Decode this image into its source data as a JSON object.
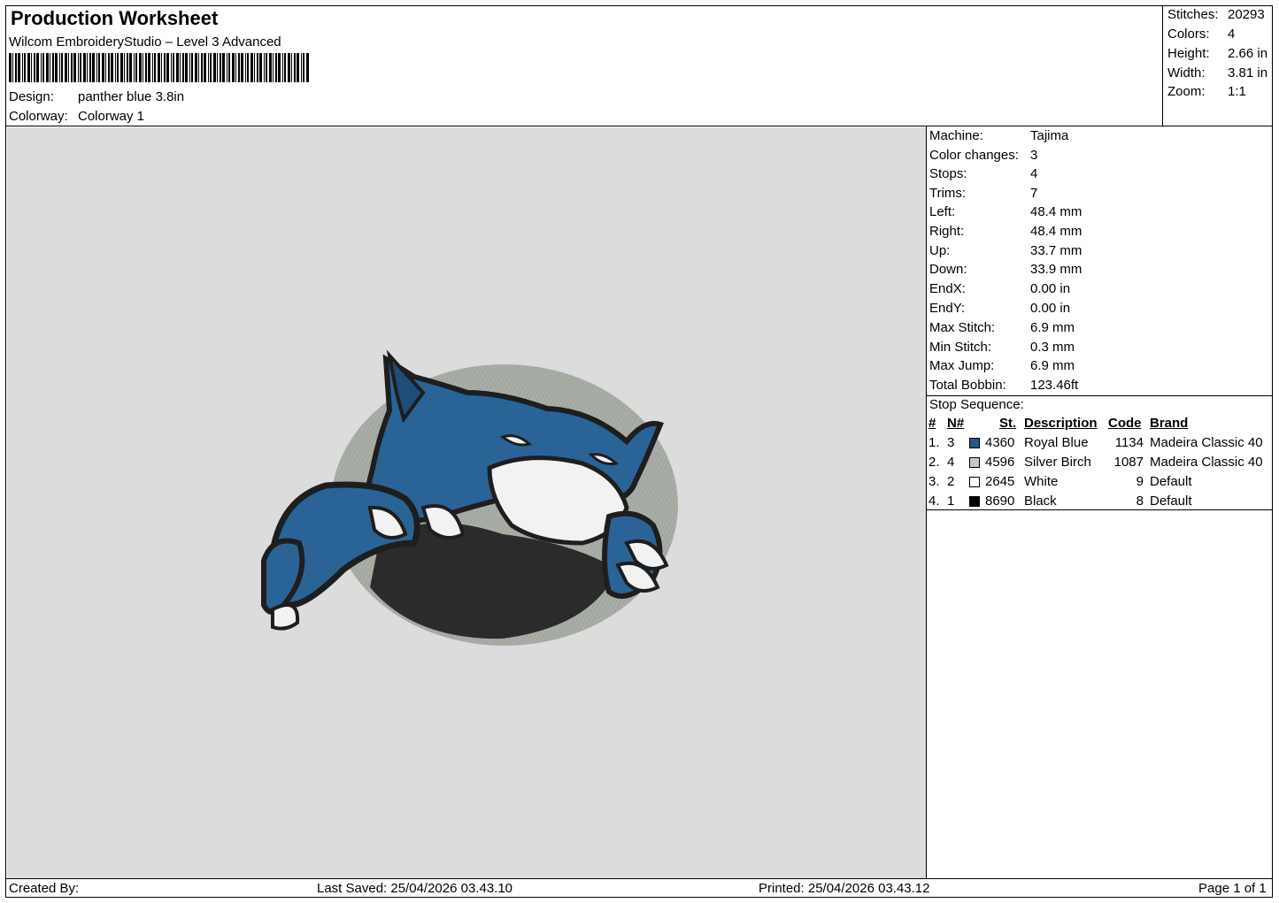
{
  "header": {
    "title": "Production Worksheet",
    "software": "Wilcom EmbroideryStudio – Level 3 Advanced",
    "design_label": "Design:",
    "design_value": "panther blue 3.8in",
    "colorway_label": "Colorway:",
    "colorway_value": "Colorway 1"
  },
  "stats": [
    {
      "label": "Stitches:",
      "value": "20293"
    },
    {
      "label": "Colors:",
      "value": "4"
    },
    {
      "label": "Height:",
      "value": "2.66 in"
    },
    {
      "label": "Width:",
      "value": "3.81 in"
    },
    {
      "label": "Zoom:",
      "value": "1:1"
    }
  ],
  "machine_info": [
    {
      "label": "Machine:",
      "value": "Tajima"
    },
    {
      "label": "Color changes:",
      "value": "3"
    },
    {
      "label": "Stops:",
      "value": "4"
    },
    {
      "label": "Trims:",
      "value": "7"
    },
    {
      "label": "Left:",
      "value": "48.4 mm"
    },
    {
      "label": "Right:",
      "value": "48.4 mm"
    },
    {
      "label": "Up:",
      "value": "33.7 mm"
    },
    {
      "label": "Down:",
      "value": "33.9 mm"
    },
    {
      "label": "EndX:",
      "value": "0.00 in"
    },
    {
      "label": "EndY:",
      "value": "0.00 in"
    },
    {
      "label": "Max Stitch:",
      "value": "6.9 mm"
    },
    {
      "label": "Min Stitch:",
      "value": "0.3 mm"
    },
    {
      "label": "Max Jump:",
      "value": "6.9 mm"
    },
    {
      "label": "Total Bobbin:",
      "value": "123.46ft"
    }
  ],
  "stop_sequence": {
    "title": "Stop Sequence:",
    "headers": {
      "num": "#",
      "n": "N#",
      "st": "St.",
      "description": "Description",
      "code": "Code",
      "brand": "Brand"
    },
    "rows": [
      {
        "num": "1.",
        "n": "3",
        "color": "#1f5a92",
        "st": "4360",
        "description": "Royal Blue",
        "code": "1134",
        "brand": "Madeira Classic 40"
      },
      {
        "num": "2.",
        "n": "4",
        "color": "#c6c9c2",
        "st": "4596",
        "description": "Silver Birch",
        "code": "1087",
        "brand": "Madeira Classic 40"
      },
      {
        "num": "3.",
        "n": "2",
        "color": "#ffffff",
        "st": "2645",
        "description": "White",
        "code": "9",
        "brand": "Default"
      },
      {
        "num": "4.",
        "n": "1",
        "color": "#000000",
        "st": "8690",
        "description": "Black",
        "code": "8",
        "brand": "Default"
      }
    ]
  },
  "footer": {
    "created_by": "Created By:",
    "last_saved": "Last Saved: 25/04/2026 03.43.10",
    "printed": "Printed: 25/04/2026 03.43.12",
    "page": "Page 1 of 1"
  },
  "colors": {
    "design_background": "#dcdcdc",
    "royal_blue": "#2a6496",
    "silver_birch": "#a8aea5",
    "white": "#f2f2f2",
    "black": "#1e1e1e"
  }
}
